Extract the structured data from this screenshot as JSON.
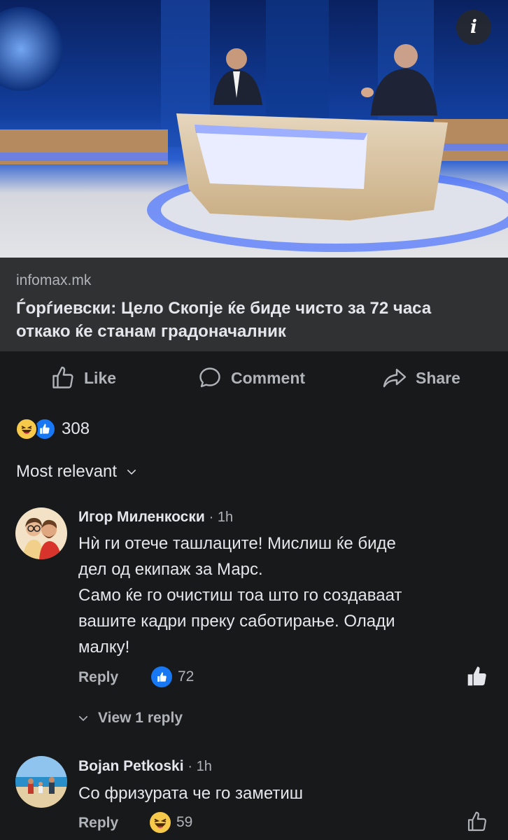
{
  "preview": {
    "domain": "infomax.mk",
    "title": "Ѓорѓиевски: Цело Скопје ќе биде чисто за 72 часа откако ќе станам градоначалник"
  },
  "actions": {
    "like": "Like",
    "comment": "Comment",
    "share": "Share"
  },
  "reactions": {
    "count": "308"
  },
  "sort": {
    "label": "Most relevant"
  },
  "comments": [
    {
      "author": "Игор Миленкоски",
      "time": "· 1h",
      "text_lines": [
        "Нѝ ги отече ташлаците! Мислиш ќе биде",
        "дел од екипаж за Марс.",
        "Само ќе го очистиш тоа што го создаваат",
        "вашите кадри преку саботирање. Олади",
        "малку!"
      ],
      "reply": "Reply",
      "likes": "72",
      "view_replies": "View 1 reply"
    },
    {
      "author": "Bojan Petkoski",
      "time": "· 1h",
      "text_lines": [
        "Со фризурата че го заметиш"
      ],
      "reply": "Reply",
      "likes": "59"
    }
  ],
  "colors": {
    "background": "#18191a",
    "card": "#303133",
    "accent_blue": "#1877f2",
    "muted": "#b0b3b8"
  }
}
